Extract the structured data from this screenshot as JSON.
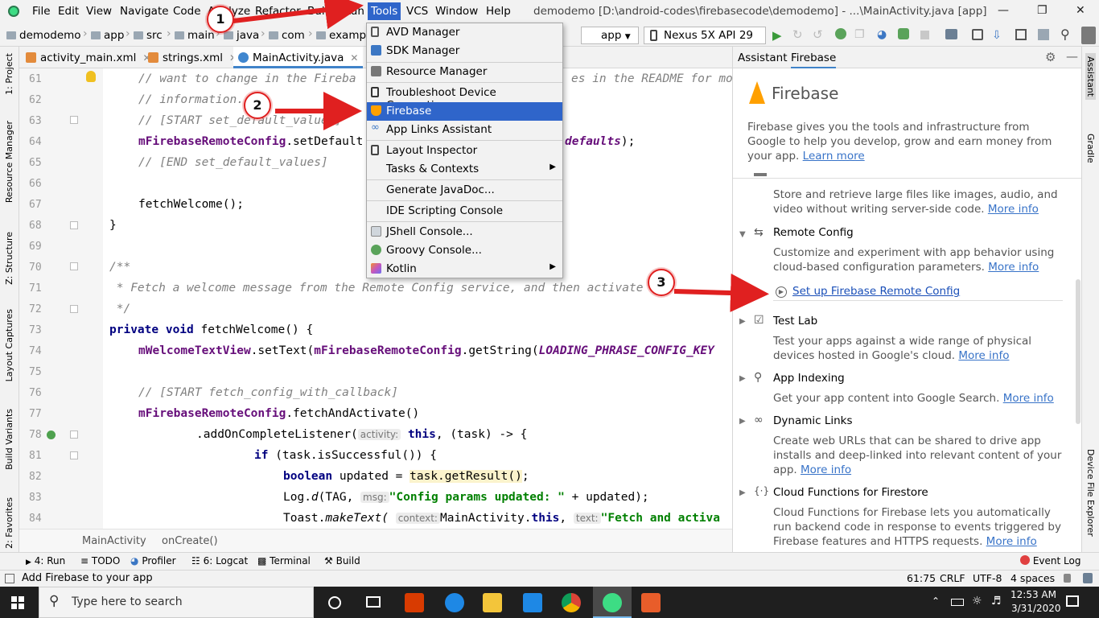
{
  "menubar": {
    "items": [
      "File",
      "Edit",
      "View",
      "Navigate",
      "Code",
      "Analyze",
      "Refactor",
      "Build",
      "Run",
      "Tools",
      "VCS",
      "Window",
      "Help"
    ],
    "active": "Tools",
    "window_title": "demodemo [D:\\android-codes\\firebasecode\\demodemo] - ...\\MainActivity.java [app]"
  },
  "navbar": {
    "crumbs": [
      "demodemo",
      "app",
      "src",
      "main",
      "java",
      "com",
      "exampl"
    ],
    "run_config": "app",
    "device": "Nexus 5X API 29"
  },
  "editor_tabs": [
    "activity_main.xml",
    "strings.xml",
    "MainActivity.java"
  ],
  "tools_menu": [
    {
      "label": "AVD Manager",
      "icon": "avd-icon"
    },
    {
      "label": "SDK Manager",
      "icon": "sdk-icon"
    },
    {
      "label": "Resource Manager",
      "icon": "resource-icon"
    },
    {
      "label": "Troubleshoot Device Connections",
      "icon": "troubleshoot-icon"
    },
    {
      "label": "Firebase",
      "icon": "firebase-icon"
    },
    {
      "label": "App Links Assistant",
      "icon": "link-icon"
    },
    {
      "label": "Layout Inspector",
      "icon": "layout-icon"
    },
    {
      "label": "Tasks & Contexts",
      "icon": ""
    },
    {
      "label": "Generate JavaDoc...",
      "icon": ""
    },
    {
      "label": "IDE Scripting Console",
      "icon": ""
    },
    {
      "label": "JShell Console...",
      "icon": "jshell-icon"
    },
    {
      "label": "Groovy Console...",
      "icon": "groovy-icon"
    },
    {
      "label": "Kotlin",
      "icon": "kotlin-icon"
    }
  ],
  "line_numbers": [
    "61",
    "62",
    "63",
    "64",
    "65",
    "66",
    "67",
    "68",
    "69",
    "70",
    "71",
    "72",
    "73",
    "74",
    "75",
    "76",
    "77",
    "78",
    "81",
    "82",
    "83",
    "84"
  ],
  "code": {
    "l61": "// want to change in the Fireba",
    "l61b": "es in the README for mo",
    "l62": "// information.",
    "l63": "// [START set_default_values]",
    "l64a": "mFirebaseRemoteConfig",
    "l64b": ".setDefault",
    "l64c": "defaults",
    "l64d": ");",
    "l65": "// [END set_default_values]",
    "l67": "fetchWelcome();",
    "l68": "}",
    "l70": "/**",
    "l71": " * Fetch a welcome message from the Remote Config service, and then activate it.",
    "l72": " */",
    "l73kw": "private void",
    "l73": " fetchWelcome() {",
    "l74a": "mWelcomeTextView",
    "l74b": ".setText(",
    "l74c": "mFirebaseRemoteConfig",
    "l74d": ".getString(",
    "l74e": "LOADING_PHRASE_CONFIG_KEY",
    "l76": "// [START fetch_config_with_callback]",
    "l77a": "mFirebaseRemoteConfig",
    "l77b": ".fetchAndActivate()",
    "l78a": ".addOnCompleteListener(",
    "l78hint": "activity:",
    "l78b": "this",
    "l78c": ", (task) -> {",
    "l81kw": "if",
    "l81": " (task.isSuccessful()) {",
    "l82kw": "boolean",
    "l82a": " updated = ",
    "l82b": "task.getResult()",
    "l82c": ";",
    "l83a": "Log.",
    "l83b": "d",
    "l83c": "(TAG,",
    "l83hint": "msg:",
    "l83d": "\"Config params updated: \"",
    "l83e": " + updated);",
    "l84a": "Toast.",
    "l84b": "makeText(",
    "l84hint1": "context:",
    "l84c": "MainActivity.",
    "l84d": "this",
    "l84e": ",",
    "l84hint2": "text:",
    "l84f": "\"Fetch and activa"
  },
  "code_breadcrumb": [
    "MainActivity",
    "onCreate()"
  ],
  "left_tool_tabs": [
    "1: Project",
    "Resource Manager",
    "Z: Structure",
    "Layout Captures",
    "Build Variants",
    "2: Favorites"
  ],
  "right_tool_tabs": [
    "Assistant",
    "Gradle",
    "Device File Explorer"
  ],
  "bottom_tabs": [
    "4: Run",
    "TODO",
    "Profiler",
    "6: Logcat",
    "Terminal",
    "Build"
  ],
  "event_log": "Event Log",
  "status": {
    "message": "Add Firebase to your app",
    "position": "61:75",
    "line_sep": "CRLF",
    "encoding": "UTF-8",
    "indent": "4 spaces"
  },
  "firebase_panel": {
    "tabs": [
      "Assistant",
      "Firebase"
    ],
    "title": "Firebase",
    "intro": "Firebase gives you the tools and infrastructure from Google to help you develop, grow and earn money from your app.",
    "intro_link": "Learn more",
    "storage_desc": "Store and retrieve large files like images, audio, and video without writing server-side code.",
    "more_info": "More info",
    "remote_config_title": "Remote Config",
    "remote_config_desc": "Customize and experiment with app behavior using cloud-based configuration parameters.",
    "remote_config_link": "Set up Firebase Remote Config",
    "test_lab_title": "Test Lab",
    "test_lab_desc": "Test your apps against a wide range of physical devices hosted in Google's cloud.",
    "app_indexing_title": "App Indexing",
    "app_indexing_desc": "Get your app content into Google Search.",
    "dynamic_links_title": "Dynamic Links",
    "dynamic_links_desc": "Create web URLs that can be shared to drive app installs and deep-linked into relevant content of your app.",
    "more_info_split_a": "More",
    "more_info_split_b": "info",
    "cloud_functions_title": "Cloud Functions for Firestore",
    "cloud_functions_desc": "Cloud Functions for Firebase lets you automatically run backend code in response to events triggered by Firebase features and HTTPS requests."
  },
  "annotations": [
    "1",
    "2",
    "3"
  ],
  "taskbar": {
    "search_placeholder": "Type here to search",
    "time": "12:53 AM",
    "date": "3/31/2020"
  },
  "colors": {
    "menu_highlight": "#2f65ca",
    "annotation_red": "#e02020",
    "link_blue": "#3873c8",
    "firebase_orange": "#ffa000"
  }
}
